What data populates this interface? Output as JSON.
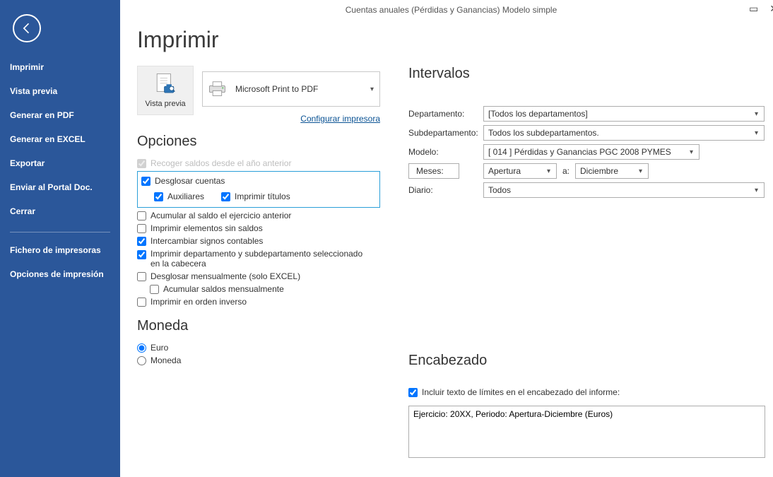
{
  "window": {
    "title": "Cuentas anuales (Pérdidas y Ganancias) Modelo simple"
  },
  "sidebar": {
    "items": [
      "Imprimir",
      "Vista previa",
      "Generar en PDF",
      "Generar en EXCEL",
      "Exportar",
      "Enviar al Portal Doc.",
      "Cerrar"
    ],
    "footer": [
      "Fichero de impresoras",
      "Opciones de impresión"
    ]
  },
  "main": {
    "title": "Imprimir",
    "vista_previa": "Vista previa",
    "printer": "Microsoft Print to PDF",
    "configure_link": "Configurar impresora"
  },
  "opciones": {
    "heading": "Opciones",
    "recoger": "Recoger saldos desde el año anterior",
    "desglosar": "Desglosar cuentas",
    "auxiliares": "Auxiliares",
    "imprimir_titulos": "Imprimir títulos",
    "acumular_saldo": "Acumular al saldo el ejercicio anterior",
    "imprimir_sin_saldos": "Imprimir elementos sin saldos",
    "intercambiar": "Intercambiar signos contables",
    "imp_dep_sub": "Imprimir departamento y subdepartamento seleccionado en la cabecera",
    "desglosar_mens": "Desglosar mensualmente (solo EXCEL)",
    "acumular_mens": "Acumular saldos mensualmente",
    "orden_inverso": "Imprimir en orden inverso"
  },
  "moneda": {
    "heading": "Moneda",
    "euro": "Euro",
    "moneda": "Moneda"
  },
  "intervalos": {
    "heading": "Intervalos",
    "departamento_lbl": "Departamento:",
    "departamento_val": "[Todos los departamentos]",
    "subdep_lbl": "Subdepartamento:",
    "subdep_val": "Todos los subdepartamentos.",
    "modelo_lbl": "Modelo:",
    "modelo_val": "[ 014 ] Pérdidas y Ganancias PGC 2008 PYMES",
    "meses_btn": "Meses:",
    "mes_inicio": "Apertura",
    "a": "a:",
    "mes_fin": "Diciembre",
    "diario_lbl": "Diario:",
    "diario_val": "Todos"
  },
  "encabezado": {
    "heading": "Encabezado",
    "incluir": "Incluir texto de límites en el encabezado del informe:",
    "texto": "Ejercicio: 20XX, Periodo: Apertura-Diciembre (Euros)"
  }
}
